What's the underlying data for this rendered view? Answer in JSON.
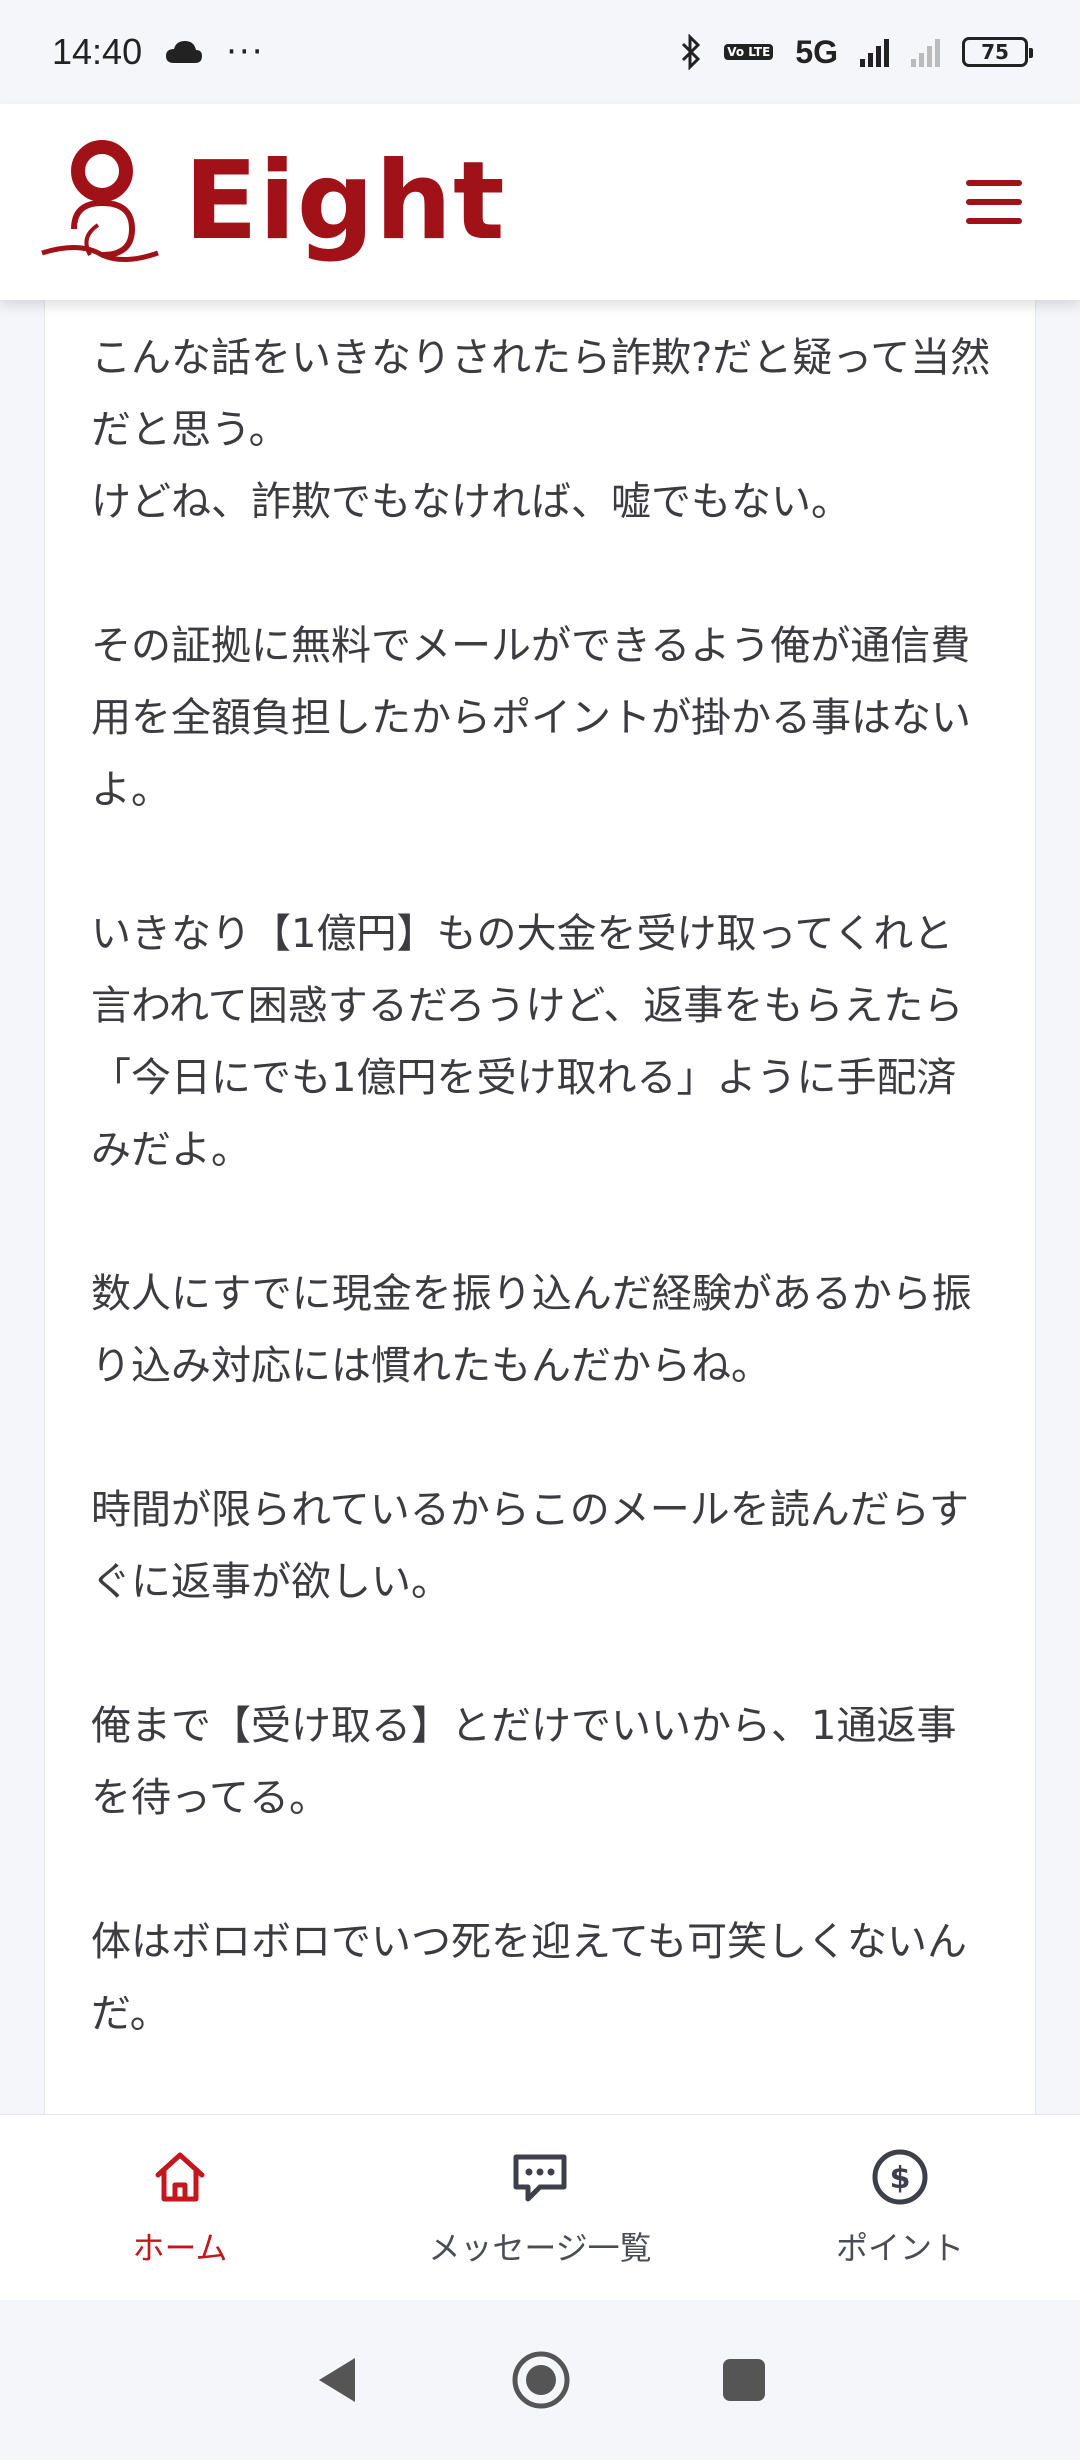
{
  "status_bar": {
    "time": "14:40",
    "more": "···",
    "network": "5G",
    "volte": "Vo LTE",
    "battery": "75"
  },
  "header": {
    "logo_text": "Eight",
    "brand_color": "#a01218"
  },
  "message": {
    "paragraphs": [
      "こんな話をいきなりされたら詐欺?だと疑って当然だと思う。\nけどね、詐欺でもなければ、嘘でもない。",
      "その証拠に無料でメールができるよう俺が通信費用を全額負担したからポイントが掛かる事はないよ。",
      "いきなり【1億円】もの大金を受け取ってくれと言われて困惑するだろうけど、返事をもらえたら「今日にでも1億円を受け取れる」ように手配済みだよ。",
      "数人にすでに現金を振り込んだ経験があるから振り込み対応には慣れたもんだからね。",
      "時間が限られているからこのメールを読んだらすぐに返事が欲しい。",
      "俺まで【受け取る】とだけでいいから、1通返事を待ってる。",
      "体はボロボロでいつ死を迎えても可笑しくないんだ。"
    ]
  },
  "bottom_nav": {
    "items": [
      {
        "label": "ホーム",
        "icon": "home-icon",
        "active": true
      },
      {
        "label": "メッセージ一覧",
        "icon": "message-icon",
        "active": false
      },
      {
        "label": "ポイント",
        "icon": "dollar-icon",
        "active": false
      }
    ],
    "active_color": "#c4161c"
  },
  "system_nav": {
    "buttons": [
      "back-icon",
      "home-circle-icon",
      "recents-icon"
    ]
  }
}
